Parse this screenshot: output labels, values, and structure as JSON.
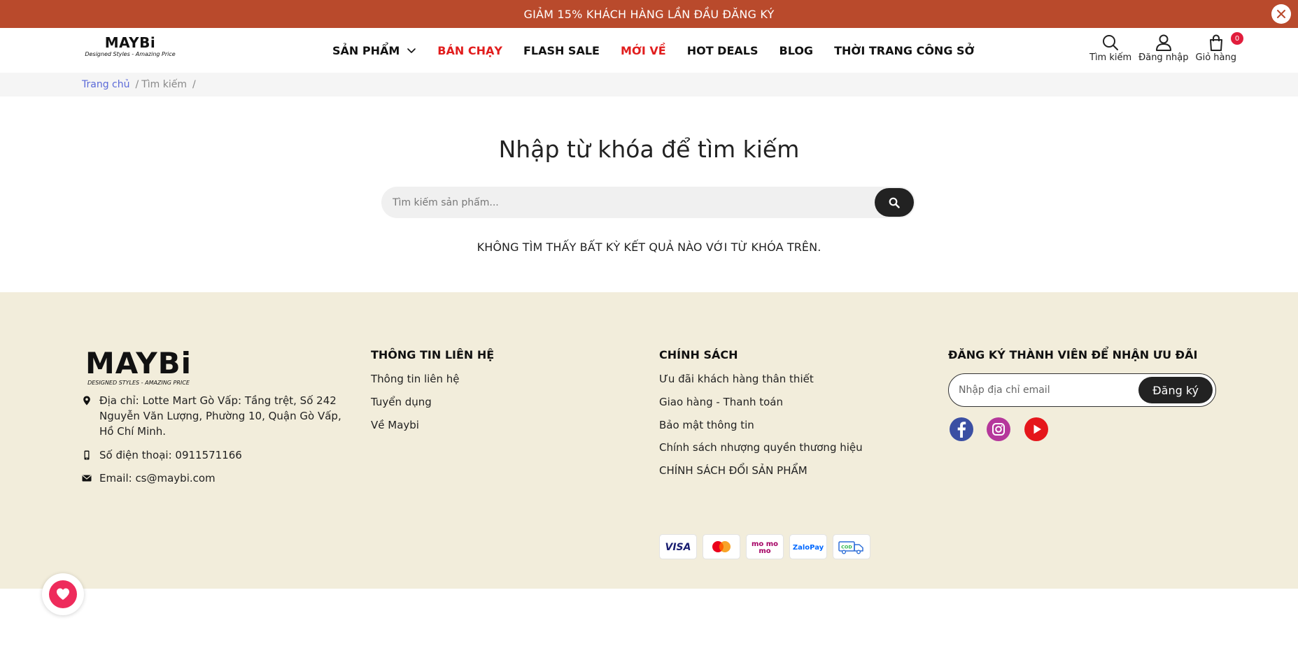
{
  "promo": {
    "text": "GIẢM 15% KHÁCH HÀNG LẦN ĐẦU ĐĂNG KÝ",
    "close_icon": "close-icon"
  },
  "header": {
    "logo": {
      "wordmark": "MAYBi",
      "tagline": "Designed Styles - Amazing Price"
    },
    "nav": [
      {
        "label": "SẢN PHẨM",
        "has_dropdown": true,
        "color": "#111111"
      },
      {
        "label": "BÁN CHẠY",
        "color": "#e11d1d"
      },
      {
        "label": "FLASH SALE",
        "color": "#111111"
      },
      {
        "label": "MỚI VỀ",
        "color": "#e11d1d"
      },
      {
        "label": "HOT DEALS",
        "color": "#111111"
      },
      {
        "label": "BLOG",
        "color": "#111111"
      },
      {
        "label": "THỜI TRANG CÔNG SỞ",
        "color": "#111111"
      }
    ],
    "actions": {
      "search_label": "Tìm kiếm",
      "login_label": "Đăng nhập",
      "cart_label": "Giỏ hàng",
      "cart_count": "0"
    }
  },
  "breadcrumb": {
    "home": "Trang chủ",
    "sep": "/",
    "current": "Tìm kiếm",
    "trailing_sep": "/"
  },
  "search": {
    "title": "Nhập từ khóa để tìm kiếm",
    "placeholder": "Tìm kiếm sản phẩm...",
    "no_result": "KHÔNG TÌM THẤY BẤT KỲ KẾT QUẢ NÀO VỚI TỪ KHÓA TRÊN."
  },
  "footer": {
    "logo": {
      "wordmark": "MAYBi",
      "tagline": "DESIGNED STYLES - AMAZING PRICE"
    },
    "contact": {
      "address": "Địa chỉ: Lotte Mart Gò Vấp: Tầng trệt, Số 242 Nguyễn Văn Lượng, Phường 10, Quận Gò Vấp, Hồ Chí Minh.",
      "phone": "Số điện thoại: 0911571166",
      "email": "Email: cs@maybi.com"
    },
    "info": {
      "heading": "THÔNG TIN LIÊN HỆ",
      "links": [
        "Thông tin liên hệ",
        "Tuyển dụng",
        "Về Maybi"
      ]
    },
    "policy": {
      "heading": "CHÍNH SÁCH",
      "links": [
        "Ưu đãi khách hàng thân thiết",
        "Giao hàng - Thanh toán",
        "Bảo mật thông tin",
        "Chính sách nhượng quyền thương hiệu",
        "CHÍNH SÁCH ĐỔI SẢN PHẨM"
      ]
    },
    "newsletter": {
      "heading": "ĐĂNG KÝ THÀNH VIÊN ĐỂ NHẬN ƯU ĐÃI",
      "placeholder": "Nhập địa chỉ email",
      "button": "Đăng ký"
    },
    "social": [
      "facebook-icon",
      "instagram-icon",
      "youtube-icon"
    ],
    "payments": {
      "visa": "VISA",
      "mastercard": "mastercard-logo",
      "momo": "mo mo",
      "zalopay": "ZaloPay",
      "cod": "COD"
    }
  },
  "colors": {
    "promo_bg": "#b94a2c",
    "footer_bg": "#f2eddb",
    "accent_red": "#e11d1d",
    "link_blue": "#5b6ad8",
    "dark_button": "#222222",
    "badge": "#e11d3c",
    "wishlist": "#ee2b5b"
  }
}
